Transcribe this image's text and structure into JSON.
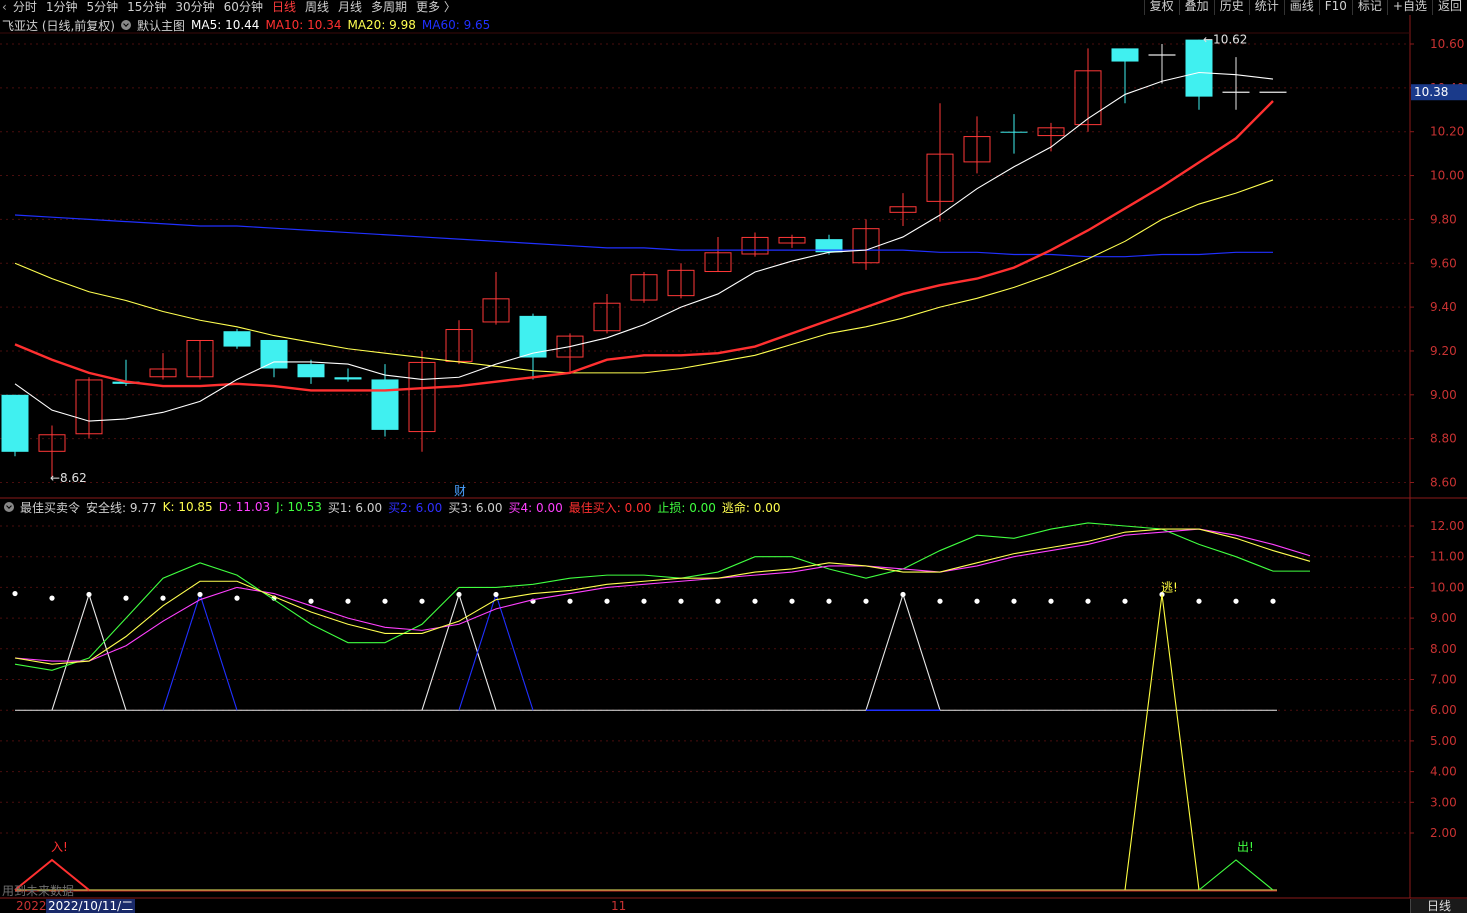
{
  "toolbar": {
    "back_icon": "chevron-left-icon",
    "periods": [
      "分时",
      "1分钟",
      "5分钟",
      "15分钟",
      "30分钟",
      "60分钟",
      "日线",
      "周线",
      "月线",
      "多周期",
      "更多 〉"
    ],
    "active_period": "日线",
    "right_buttons": [
      "复权",
      "叠加",
      "历史",
      "统计",
      "画线",
      "F10",
      "标记",
      "+自选",
      "返回"
    ]
  },
  "main_header": {
    "title": "飞亚达 (日线,前复权)",
    "template": "默认主图",
    "ma5": "MA5: 10.44",
    "ma10": "MA10: 10.34",
    "ma20": "MA20: 9.98",
    "ma60": "MA60: 9.65",
    "colors": {
      "ma5": "#ffffff",
      "ma10": "#ff3030",
      "ma20": "#ffff50",
      "ma60": "#2030ff"
    }
  },
  "indicator_header": {
    "title": "最佳买卖令",
    "safe": "安全线: 9.77",
    "k": "K: 10.85",
    "d": "D: 11.03",
    "j": "J: 10.53",
    "b1": "买1: 6.00",
    "b2": "买2: 6.00",
    "b3": "买3: 6.00",
    "b4": "买4: 0.00",
    "best": "最佳买入: 0.00",
    "stop": "止损: 0.00",
    "escape": "逃命: 0.00",
    "colors": {
      "k": "#ffff50",
      "d": "#ff40ff",
      "j": "#40ff40",
      "b2": "#3030ff",
      "b4": "#ff40ff",
      "best": "#ff3030",
      "stop": "#40ff40",
      "escape": "#ffff50"
    }
  },
  "price_axis": [
    "10.60",
    "10.40",
    "10.20",
    "10.00",
    "9.80",
    "9.60",
    "9.40",
    "9.20",
    "9.00",
    "8.80",
    "8.60"
  ],
  "current_price": "10.38",
  "indicator_axis": [
    "12.00",
    "11.00",
    "10.00",
    "9.00",
    "8.00",
    "7.00",
    "6.00",
    "5.00",
    "4.00",
    "3.00",
    "2.00"
  ],
  "annotations": {
    "high": "10.62",
    "low": "8.62",
    "finance_mark": "财",
    "escape_mark": "逃!",
    "enter_mark": "入!",
    "exit_mark": "出!",
    "future_note": "用到未来数据"
  },
  "bottom": {
    "left_date_prefix": "2022",
    "cursor_date": "2022/10/11/二",
    "month_mark": "11",
    "tab": "日线"
  },
  "chart_data": {
    "type": "candlestick",
    "ylim": [
      8.55,
      10.68
    ],
    "candles": [
      {
        "o": 9.0,
        "h": 9.0,
        "l": 8.72,
        "c": 8.74,
        "color": "cyan"
      },
      {
        "o": 8.74,
        "h": 8.86,
        "l": 8.62,
        "c": 8.82,
        "color": "red"
      },
      {
        "o": 8.82,
        "h": 9.08,
        "l": 8.8,
        "c": 9.07,
        "color": "red"
      },
      {
        "o": 9.05,
        "h": 9.16,
        "l": 9.04,
        "c": 9.06,
        "color": "cyan"
      },
      {
        "o": 9.08,
        "h": 9.19,
        "l": 9.07,
        "c": 9.12,
        "color": "red"
      },
      {
        "o": 9.08,
        "h": 9.25,
        "l": 9.07,
        "c": 9.25,
        "color": "red"
      },
      {
        "o": 9.29,
        "h": 9.3,
        "l": 9.21,
        "c": 9.22,
        "color": "cyan"
      },
      {
        "o": 9.25,
        "h": 9.25,
        "l": 9.08,
        "c": 9.12,
        "color": "cyan"
      },
      {
        "o": 9.14,
        "h": 9.16,
        "l": 9.05,
        "c": 9.08,
        "color": "cyan"
      },
      {
        "o": 9.08,
        "h": 9.12,
        "l": 9.06,
        "c": 9.07,
        "color": "cyan"
      },
      {
        "o": 9.07,
        "h": 9.14,
        "l": 8.81,
        "c": 8.84,
        "color": "cyan"
      },
      {
        "o": 8.83,
        "h": 9.2,
        "l": 8.74,
        "c": 9.15,
        "color": "red"
      },
      {
        "o": 9.15,
        "h": 9.34,
        "l": 9.14,
        "c": 9.3,
        "color": "red"
      },
      {
        "o": 9.33,
        "h": 9.56,
        "l": 9.32,
        "c": 9.44,
        "color": "red"
      },
      {
        "o": 9.36,
        "h": 9.37,
        "l": 9.07,
        "c": 9.17,
        "color": "cyan"
      },
      {
        "o": 9.17,
        "h": 9.28,
        "l": 9.1,
        "c": 9.27,
        "color": "red"
      },
      {
        "o": 9.29,
        "h": 9.46,
        "l": 9.28,
        "c": 9.42,
        "color": "red"
      },
      {
        "o": 9.43,
        "h": 9.56,
        "l": 9.42,
        "c": 9.55,
        "color": "red"
      },
      {
        "o": 9.45,
        "h": 9.6,
        "l": 9.44,
        "c": 9.57,
        "color": "red"
      },
      {
        "o": 9.56,
        "h": 9.72,
        "l": 9.56,
        "c": 9.65,
        "color": "red"
      },
      {
        "o": 9.64,
        "h": 9.74,
        "l": 9.63,
        "c": 9.72,
        "color": "red"
      },
      {
        "o": 9.69,
        "h": 9.73,
        "l": 9.67,
        "c": 9.72,
        "color": "red"
      },
      {
        "o": 9.71,
        "h": 9.73,
        "l": 9.64,
        "c": 9.65,
        "color": "cyan"
      },
      {
        "o": 9.6,
        "h": 9.8,
        "l": 9.57,
        "c": 9.76,
        "color": "red"
      },
      {
        "o": 9.83,
        "h": 9.92,
        "l": 9.77,
        "c": 9.86,
        "color": "red"
      },
      {
        "o": 9.88,
        "h": 10.33,
        "l": 9.79,
        "c": 10.1,
        "color": "red"
      },
      {
        "o": 10.06,
        "h": 10.27,
        "l": 10.01,
        "c": 10.18,
        "color": "red"
      },
      {
        "o": 10.2,
        "h": 10.28,
        "l": 10.1,
        "c": 10.2,
        "color": "cyan"
      },
      {
        "o": 10.18,
        "h": 10.24,
        "l": 10.11,
        "c": 10.22,
        "color": "red"
      },
      {
        "o": 10.23,
        "h": 10.58,
        "l": 10.2,
        "c": 10.48,
        "color": "red"
      },
      {
        "o": 10.58,
        "h": 10.58,
        "l": 10.33,
        "c": 10.52,
        "color": "cyan"
      },
      {
        "o": 10.55,
        "h": 10.6,
        "l": 10.42,
        "c": 10.55,
        "color": "white"
      },
      {
        "o": 10.62,
        "h": 10.62,
        "l": 10.3,
        "c": 10.36,
        "color": "cyan"
      },
      {
        "o": 10.38,
        "h": 10.54,
        "l": 10.3,
        "c": 10.38,
        "color": "white"
      },
      {
        "o": 10.38,
        "h": 10.38,
        "l": 10.38,
        "c": 10.38,
        "color": "white"
      }
    ],
    "ma5": [
      9.05,
      8.93,
      8.88,
      8.89,
      8.92,
      8.97,
      9.07,
      9.15,
      9.15,
      9.14,
      9.09,
      9.07,
      9.08,
      9.14,
      9.19,
      9.22,
      9.26,
      9.32,
      9.4,
      9.46,
      9.56,
      9.61,
      9.65,
      9.66,
      9.72,
      9.82,
      9.94,
      10.04,
      10.13,
      10.26,
      10.37,
      10.43,
      10.47,
      10.46,
      10.44
    ],
    "ma10": [
      9.23,
      9.16,
      9.1,
      9.06,
      9.04,
      9.04,
      9.05,
      9.04,
      9.02,
      9.02,
      9.02,
      9.03,
      9.04,
      9.06,
      9.08,
      9.1,
      9.16,
      9.18,
      9.18,
      9.19,
      9.22,
      9.28,
      9.34,
      9.4,
      9.46,
      9.5,
      9.53,
      9.58,
      9.66,
      9.75,
      9.85,
      9.95,
      10.06,
      10.17,
      10.34
    ],
    "ma20": [
      9.6,
      9.53,
      9.47,
      9.43,
      9.38,
      9.34,
      9.31,
      9.27,
      9.24,
      9.21,
      9.19,
      9.17,
      9.15,
      9.13,
      9.11,
      9.1,
      9.1,
      9.1,
      9.12,
      9.15,
      9.18,
      9.23,
      9.28,
      9.31,
      9.35,
      9.4,
      9.44,
      9.49,
      9.55,
      9.62,
      9.7,
      9.8,
      9.87,
      9.92,
      9.98
    ],
    "ma60": [
      9.82,
      9.81,
      9.8,
      9.79,
      9.78,
      9.77,
      9.77,
      9.76,
      9.75,
      9.74,
      9.73,
      9.72,
      9.71,
      9.7,
      9.69,
      9.68,
      9.67,
      9.67,
      9.66,
      9.66,
      9.66,
      9.66,
      9.66,
      9.66,
      9.66,
      9.65,
      9.65,
      9.64,
      9.64,
      9.63,
      9.63,
      9.64,
      9.64,
      9.65,
      9.65
    ],
    "indicator": {
      "ylim": [
        0.6,
        12.6
      ],
      "safe_line": 9.77,
      "k": [
        7.7,
        7.5,
        7.6,
        8.4,
        9.4,
        10.2,
        10.2,
        9.7,
        9.2,
        8.8,
        8.5,
        8.5,
        8.9,
        9.6,
        9.8,
        9.9,
        10.1,
        10.2,
        10.3,
        10.3,
        10.5,
        10.6,
        10.8,
        10.7,
        10.5,
        10.5,
        10.8,
        11.1,
        11.3,
        11.5,
        11.8,
        11.9,
        11.9,
        11.6,
        11.2,
        10.85
      ],
      "d": [
        7.7,
        7.6,
        7.6,
        8.1,
        8.9,
        9.6,
        10.0,
        9.8,
        9.4,
        9.0,
        8.7,
        8.6,
        8.8,
        9.3,
        9.6,
        9.8,
        10.0,
        10.1,
        10.2,
        10.3,
        10.4,
        10.5,
        10.7,
        10.7,
        10.6,
        10.5,
        10.7,
        11.0,
        11.2,
        11.4,
        11.7,
        11.8,
        11.9,
        11.7,
        11.4,
        11.03
      ],
      "j": [
        7.5,
        7.3,
        7.7,
        9.0,
        10.3,
        10.8,
        10.4,
        9.6,
        8.8,
        8.2,
        8.2,
        8.8,
        10.0,
        10.0,
        10.1,
        10.3,
        10.4,
        10.4,
        10.3,
        10.5,
        11.0,
        11.0,
        10.6,
        10.3,
        10.6,
        11.2,
        11.7,
        11.6,
        11.9,
        12.1,
        12.0,
        11.9,
        11.4,
        11.0,
        10.53,
        10.53
      ]
    }
  }
}
